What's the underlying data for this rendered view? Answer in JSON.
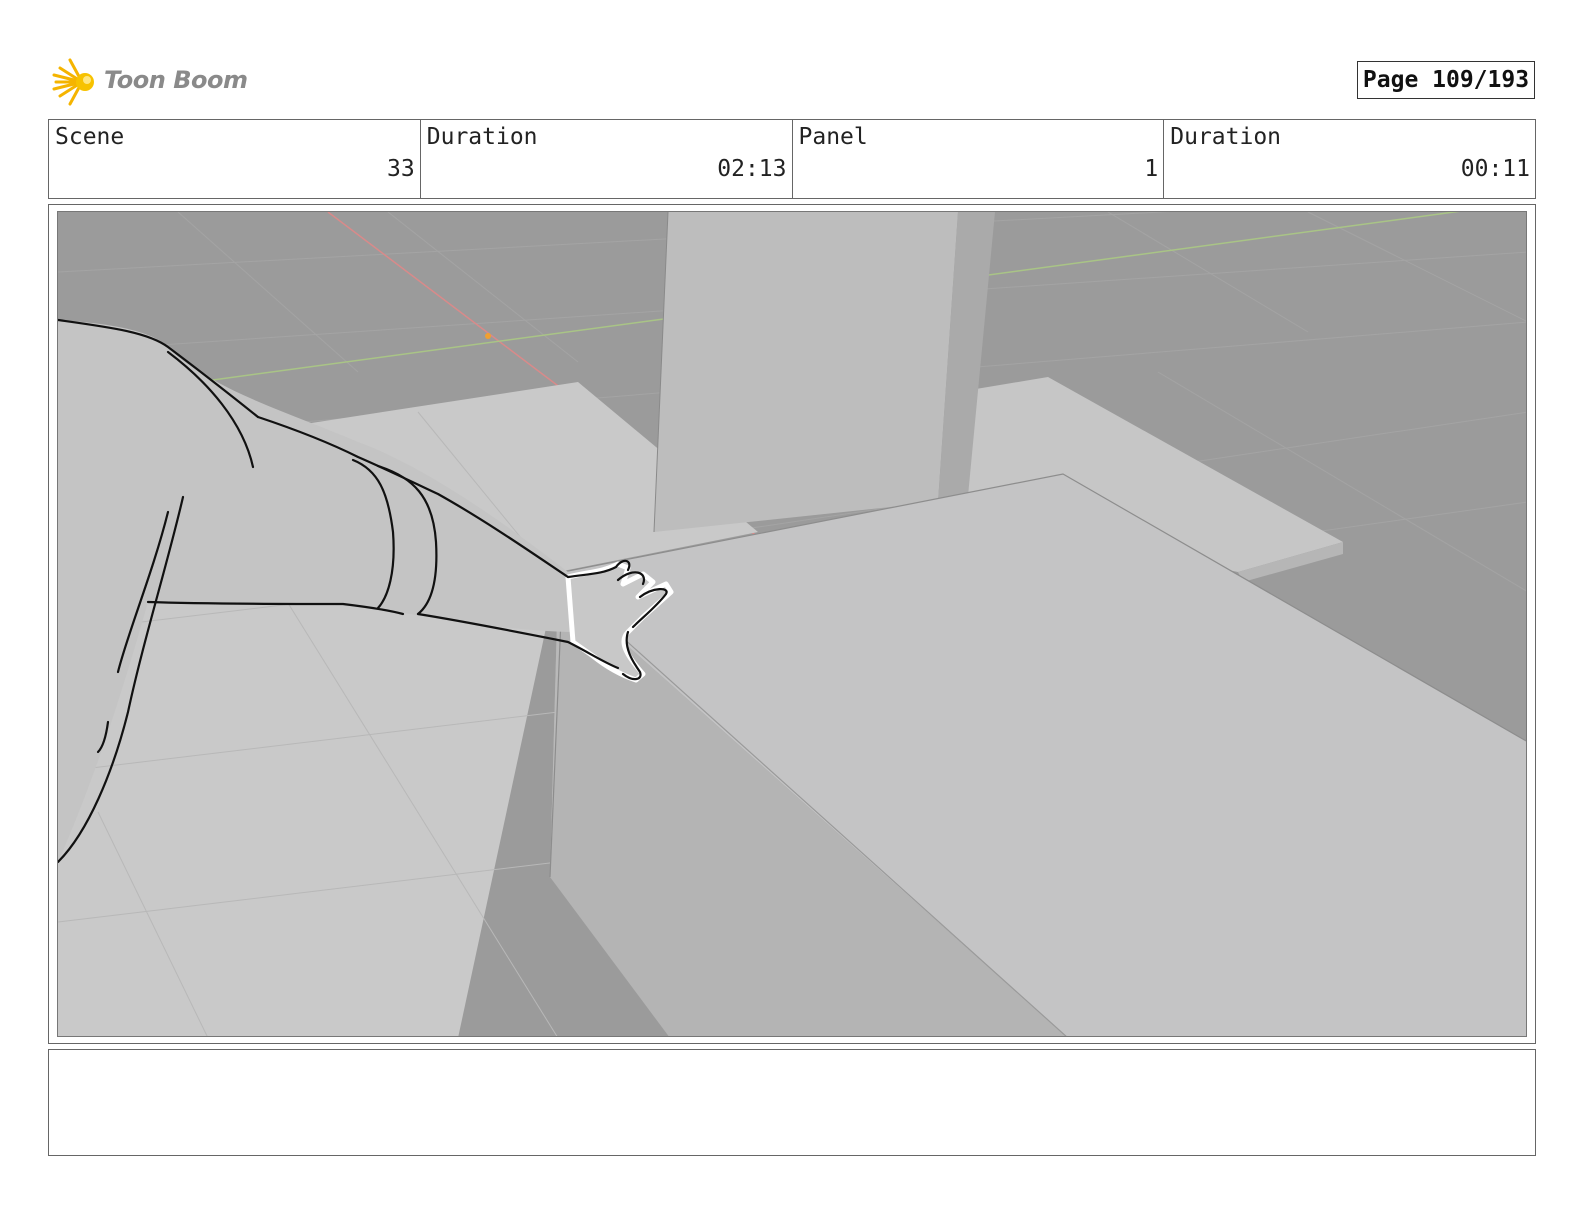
{
  "header": {
    "logo_text": "Toon Boom",
    "page_indicator": "Page 109/193"
  },
  "info": {
    "scene_label": "Scene",
    "scene_value": "33",
    "scene_duration_label": "Duration",
    "scene_duration_value": "02:13",
    "panel_label": "Panel",
    "panel_value": "1",
    "panel_duration_label": "Duration",
    "panel_duration_value": "00:11"
  },
  "panel": {
    "image": "3D layout sketch: character arm reaching toward a table edge on a grey grid floor"
  },
  "notes": {
    "text": ""
  }
}
